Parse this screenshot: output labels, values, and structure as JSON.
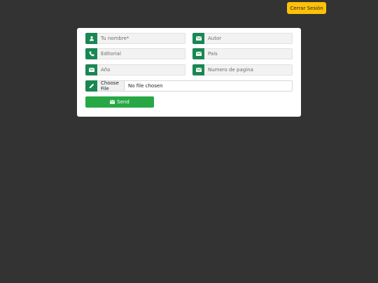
{
  "header": {
    "logout_label": "Cerrar Sesión"
  },
  "form": {
    "name_placeholder": "Tu nombre*",
    "author_placeholder": "Autor",
    "publisher_placeholder": "Editorial",
    "country_placeholder": "Pais",
    "year_placeholder": "Año",
    "page_number_placeholder": "Numero de pagina",
    "file_button_label": "Choose File",
    "file_status": "No file chosen",
    "send_label": "Send"
  },
  "icons": {
    "name": "user-icon",
    "author": "envelope-icon",
    "publisher": "phone-icon",
    "country": "envelope-icon",
    "year": "envelope-icon",
    "page_number": "envelope-icon",
    "file": "pencil-icon",
    "send": "envelope-icon"
  },
  "colors": {
    "page_background": "#333333",
    "card_background": "#ffffff",
    "icon_background": "#198754",
    "send_button": "#28a745",
    "logout_button": "#ffc107"
  }
}
